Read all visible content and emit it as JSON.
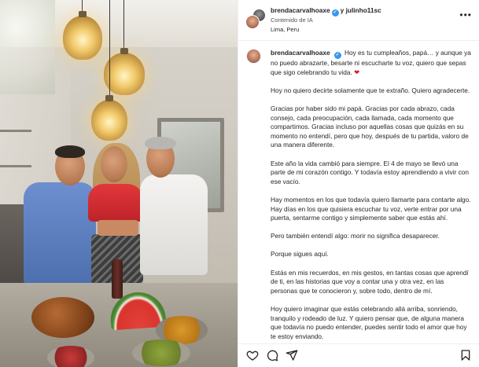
{
  "post": {
    "author": "brendacarvalhoaxe",
    "collaborator_joiner": "y",
    "collaborator": "julinho11sc",
    "ai_label": "Contenido de IA",
    "location": "Lima, Peru"
  },
  "caption": {
    "username": "brendacarvalhoaxe",
    "first_line": "Hoy es tu cumpleaños, papá… y aunque ya no puedo abrazarte, besarte ni escucharte tu voz, quiero que sepas que sigo celebrando tu vida.",
    "heart_emoji": "❤",
    "paragraphs": [
      "Hoy no quiero decirte solamente que te extraño. Quiero agradecerte.",
      "Gracias por haber sido mi papá. Gracias por cada abrazo, cada consejo, cada preocupación, cada llamada, cada momento que compartimos. Gracias incluso por aquellas cosas que quizás en su momento no entendí, pero que hoy, después de tu partida, valoro de una manera diferente.",
      "Este año la vida cambió para siempre. El 4 de mayo se llevó una parte de mi corazón contigo. Y todavía estoy aprendiendo a vivir con ese vacío.",
      "Hay momentos en los que todavía quiero llamarte para contarte algo. Hay días en los que quisiera escuchar tu voz, verte entrar por una puerta, sentarme contigo y simplemente saber que estás ahí.",
      "Pero también entendí algo: morir no significa desaparecer.",
      "Porque sigues aquí.",
      "Estás en mis recuerdos, en mis gestos, en tantas cosas que aprendí de ti, en las historias que voy a contar una y otra vez, en las personas que te conocieron y, sobre todo, dentro de mí.",
      "Hoy quiero imaginar que estás celebrando allá arriba, sonriendo, tranquilo y rodeado de luz. Y quiero pensar que, de alguna manera que todavía no puedo entender, puedes sentir todo el amor que hoy te estoy enviando."
    ]
  },
  "colors": {
    "verified": "#3797f0",
    "heart": "#d1202f",
    "text": "#262626"
  },
  "icons": [
    "more-icon",
    "heart-icon",
    "comment-icon",
    "share-icon",
    "bookmark-icon",
    "verified-icon"
  ]
}
